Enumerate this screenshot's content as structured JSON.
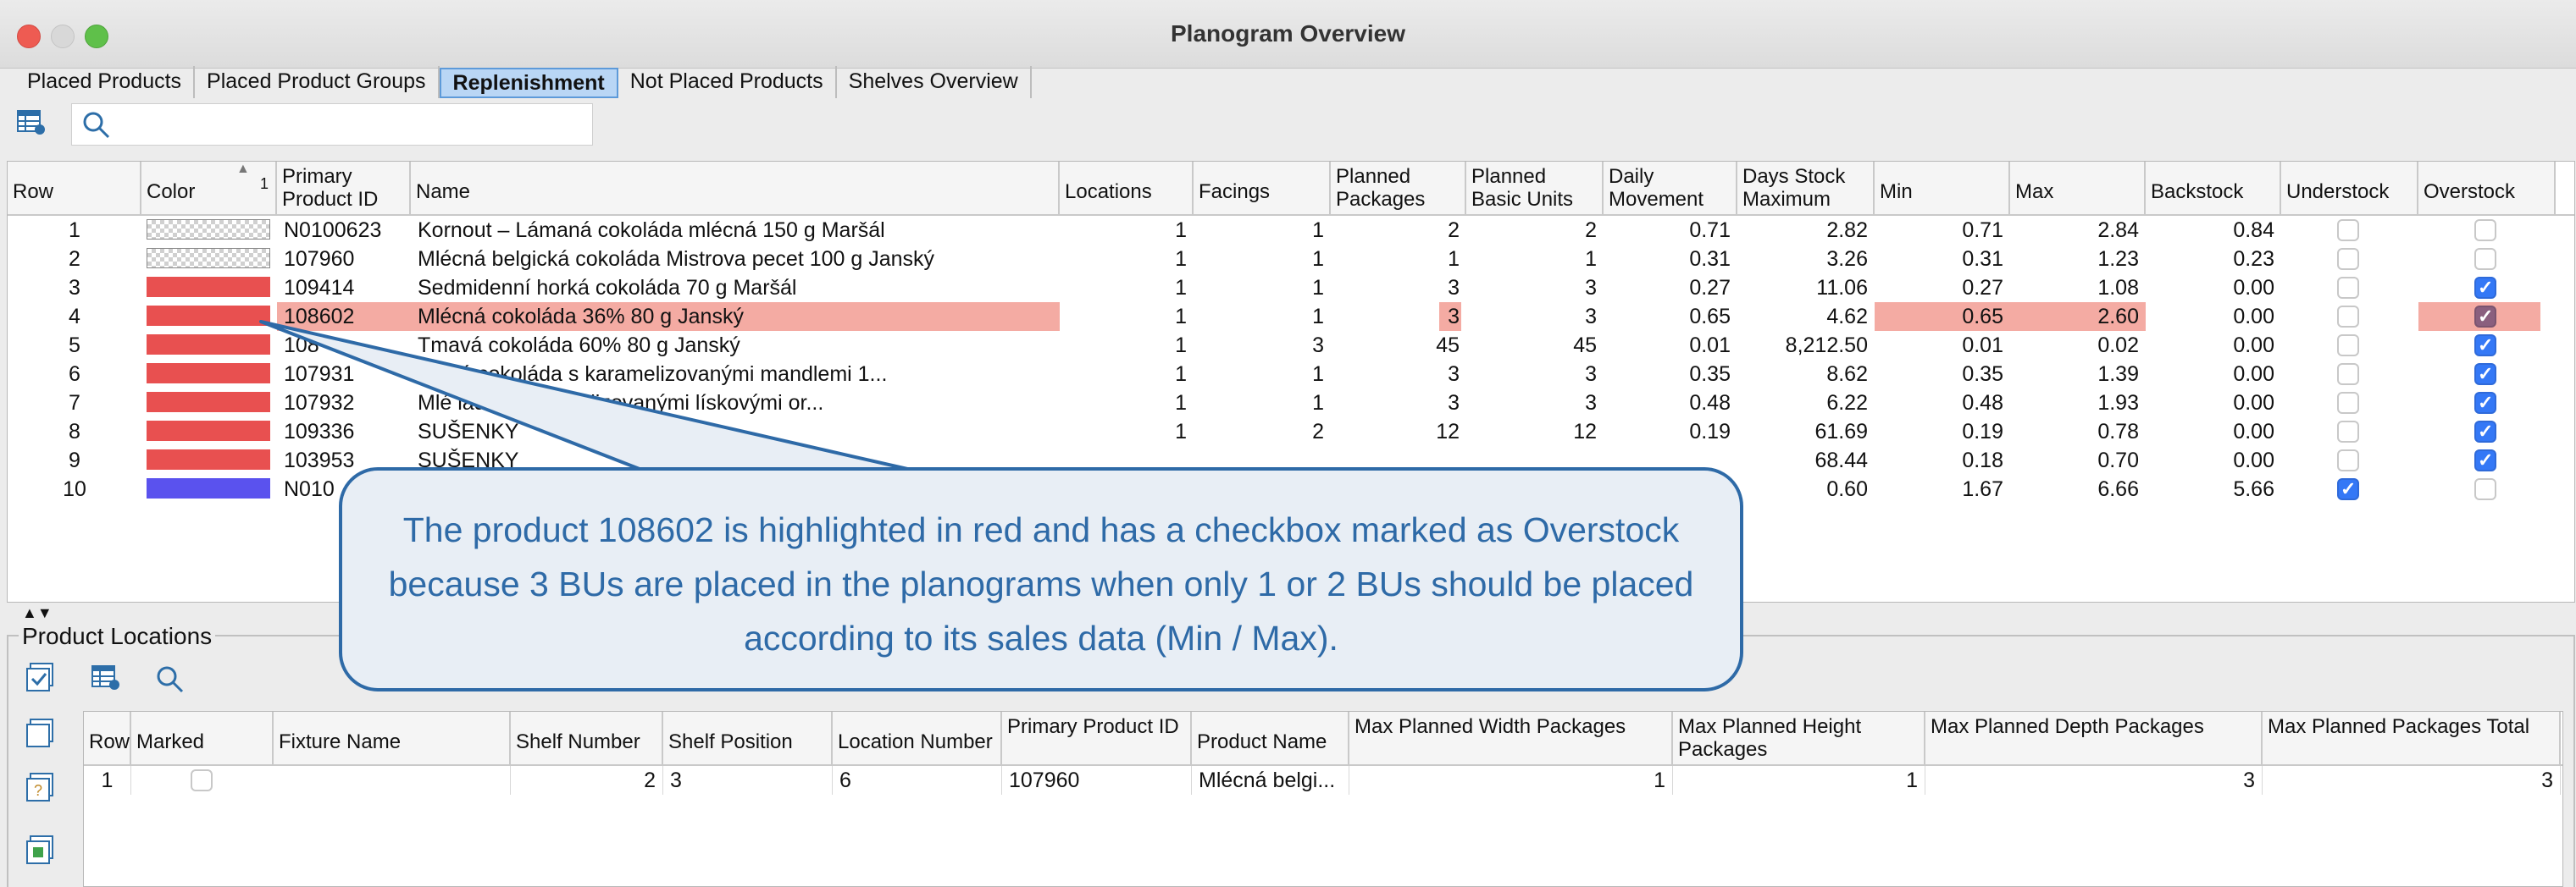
{
  "window": {
    "title": "Planogram Overview"
  },
  "tabs": [
    "Placed Products",
    "Placed Product Groups",
    "Replenishment",
    "Not Placed Products",
    "Shelves Overview"
  ],
  "active_tab": "Replenishment",
  "toolbar": {
    "search_value": ""
  },
  "main_table": {
    "headers": [
      "Row",
      "Color",
      "Primary Product ID",
      "Name",
      "Locations",
      "Facings",
      "Planned Packages",
      "Planned Basic Units",
      "Daily Movement",
      "Days Stock Maximum",
      "Min",
      "Max",
      "Backstock",
      "Understock",
      "Overstock"
    ],
    "sort_indicator": "1",
    "rows": [
      {
        "row": "1",
        "color": "pattern",
        "id": "N0100623",
        "name": "Kornout – Lámaná cokoláda mlécná 150 g Maršál",
        "locations": "1",
        "facings": "1",
        "packages": "2",
        "basic_units": "2",
        "daily": "0.71",
        "days_max": "2.82",
        "min": "0.71",
        "max": "2.84",
        "backstock": "0.84",
        "under": false,
        "over": false
      },
      {
        "row": "2",
        "color": "pattern",
        "id": "107960",
        "name": "Mlécná belgická cokoláda Mistrova pecet 100 g Janský",
        "locations": "1",
        "facings": "1",
        "packages": "1",
        "basic_units": "1",
        "daily": "0.31",
        "days_max": "3.26",
        "min": "0.31",
        "max": "1.23",
        "backstock": "0.23",
        "under": false,
        "over": false
      },
      {
        "row": "3",
        "color": "#e85050",
        "id": "109414",
        "name": "Sedmidenní horká cokoláda 70 g Maršál",
        "locations": "1",
        "facings": "1",
        "packages": "3",
        "basic_units": "3",
        "daily": "0.27",
        "days_max": "11.06",
        "min": "0.27",
        "max": "1.08",
        "backstock": "0.00",
        "under": false,
        "over": true
      },
      {
        "row": "4",
        "color": "#e85050",
        "id": "108602",
        "name": "Mlécná cokoláda 36% 80 g Janský",
        "locations": "1",
        "facings": "1",
        "packages": "3",
        "basic_units": "3",
        "daily": "0.65",
        "days_max": "4.62",
        "min": "0.65",
        "max": "2.60",
        "backstock": "0.00",
        "under": false,
        "over": true
      },
      {
        "row": "5",
        "color": "#e85050",
        "id": "108",
        "name": "Tmavá cokoláda 60% 80 g Janský",
        "locations": "1",
        "facings": "3",
        "packages": "45",
        "basic_units": "45",
        "daily": "0.01",
        "days_max": "8,212.50",
        "min": "0.01",
        "max": "0.02",
        "backstock": "0.00",
        "under": false,
        "over": true
      },
      {
        "row": "6",
        "color": "#e85050",
        "id": "107931",
        "name": "lgická cokoláda s karamelizovanými mandlemi 1...",
        "locations": "1",
        "facings": "1",
        "packages": "3",
        "basic_units": "3",
        "daily": "0.35",
        "days_max": "8.62",
        "min": "0.35",
        "max": "1.39",
        "backstock": "0.00",
        "under": false,
        "over": true
      },
      {
        "row": "7",
        "color": "#e85050",
        "id": "107932",
        "name": "Mlé          láda s karamelizovanými lískovými or...",
        "locations": "1",
        "facings": "1",
        "packages": "3",
        "basic_units": "3",
        "daily": "0.48",
        "days_max": "6.22",
        "min": "0.48",
        "max": "1.93",
        "backstock": "0.00",
        "under": false,
        "over": true
      },
      {
        "row": "8",
        "color": "#e85050",
        "id": "109336",
        "name": "SUŠENKY",
        "locations": "1",
        "facings": "2",
        "packages": "12",
        "basic_units": "12",
        "daily": "0.19",
        "days_max": "61.69",
        "min": "0.19",
        "max": "0.78",
        "backstock": "0.00",
        "under": false,
        "over": true
      },
      {
        "row": "9",
        "color": "#e85050",
        "id": "103953",
        "name": "SUŠENKY",
        "locations": "",
        "facings": "",
        "packages": "",
        "basic_units": "",
        "daily": "",
        "days_max": "68.44",
        "min": "0.18",
        "max": "0.70",
        "backstock": "0.00",
        "under": false,
        "over": true
      },
      {
        "row": "10",
        "color": "#5a52ee",
        "id": "N010",
        "name": "",
        "locations": "",
        "facings": "",
        "packages": "",
        "basic_units": "",
        "daily": "",
        "days_max": "0.60",
        "min": "1.67",
        "max": "6.66",
        "backstock": "5.66",
        "under": true,
        "over": false
      }
    ]
  },
  "callout": {
    "text": "The product 108602 is highlighted in red and has a checkbox marked as Overstock because 3 BUs are placed in the planograms when only 1 or 2 BUs should be placed according to its sales data (Min / Max)."
  },
  "locations_section": {
    "title": "Product Locations",
    "headers": [
      "Row",
      "Marked",
      "Fixture Name",
      "Shelf Number",
      "Shelf Position",
      "Location Number",
      "Primary Product ID",
      "Product Name",
      "Max Planned Width Packages",
      "Max Planned Height Packages",
      "Max Planned Depth Packages",
      "Max Planned Packages Total"
    ],
    "rows": [
      {
        "row": "1",
        "marked": false,
        "fixture": "",
        "shelf_number": "2",
        "shelf_position": "3",
        "location_number": "6",
        "product_id": "107960",
        "product_name": "Mlécná belgi...",
        "width": "1",
        "height": "1",
        "depth": "3",
        "total": "3"
      }
    ]
  },
  "colors": {
    "highlight": "#f4aba3",
    "accent": "#2e6aa7",
    "swatch_red": "#e85050",
    "swatch_blue": "#5a52ee"
  }
}
